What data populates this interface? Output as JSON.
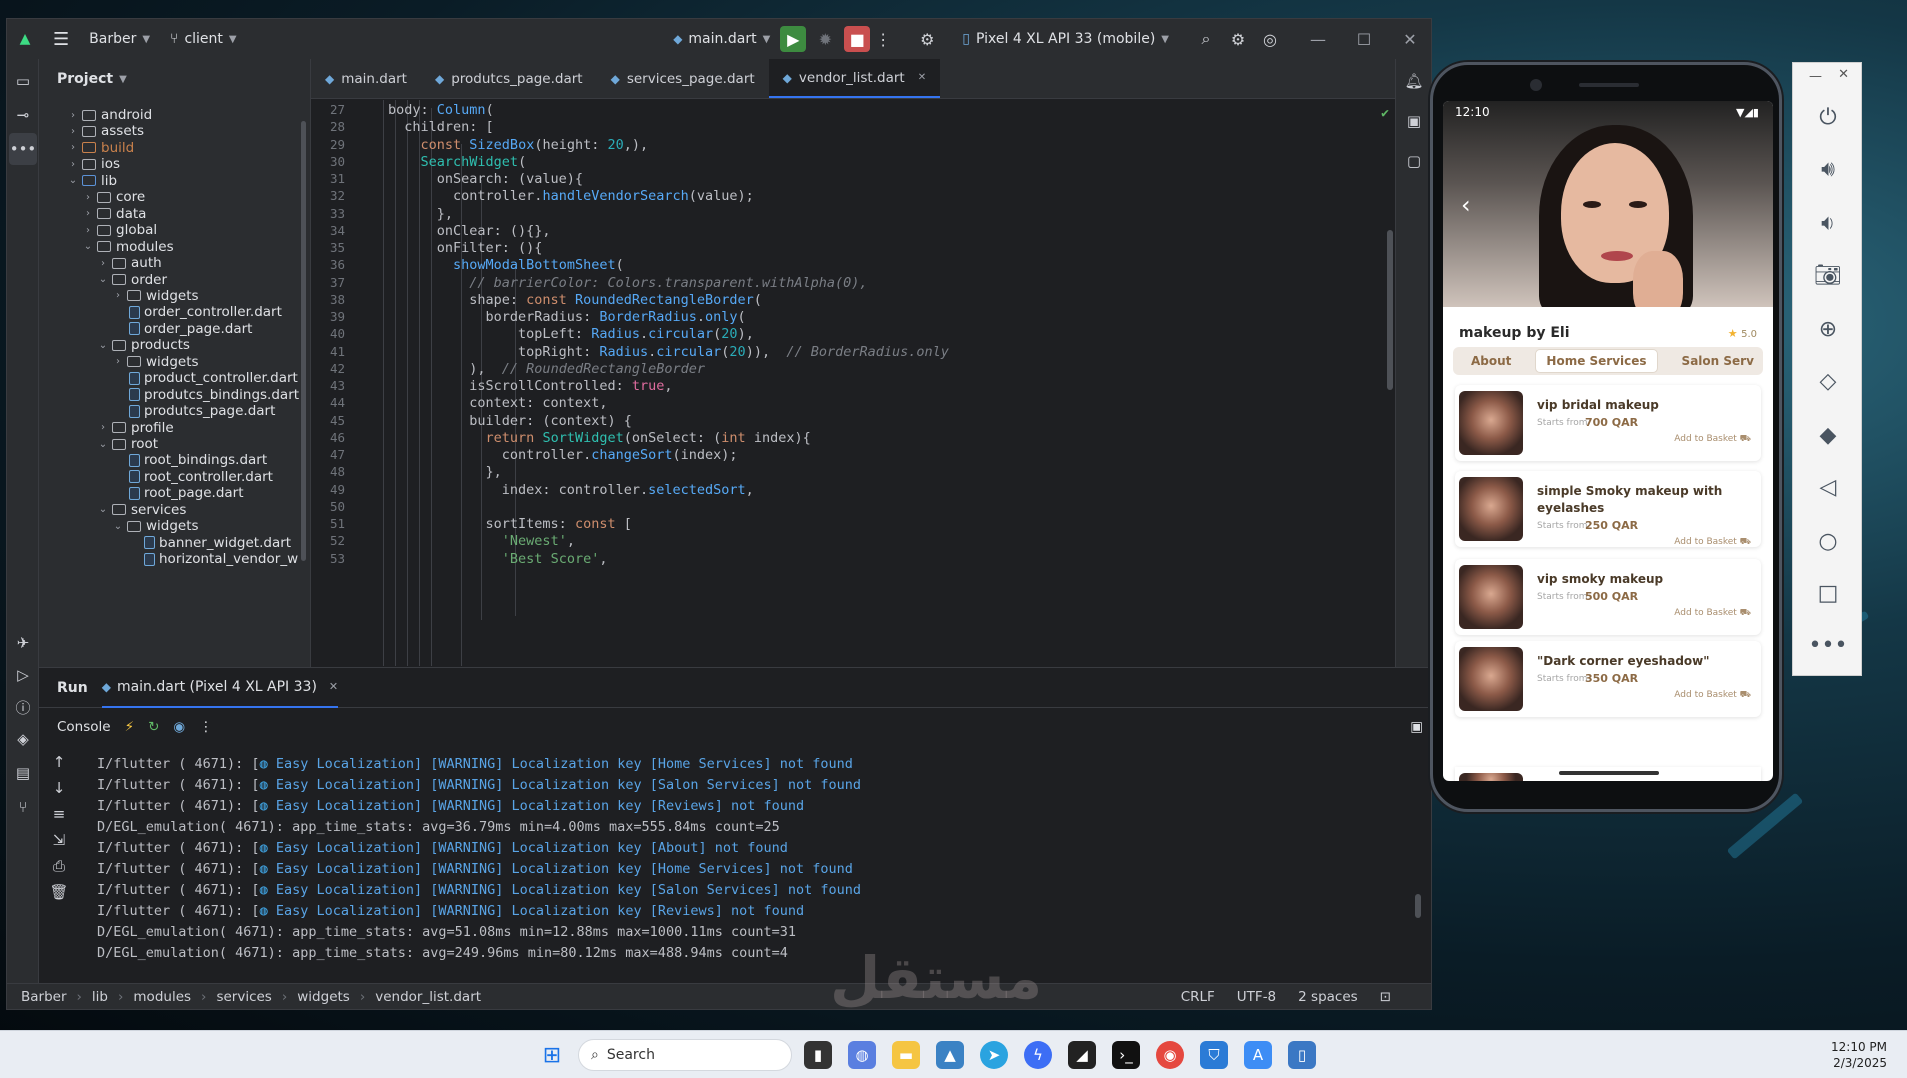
{
  "titlebar": {
    "project": "Barber",
    "branch": "client",
    "run_config": "main.dart",
    "device": "Pixel 4 XL API 33 (mobile)"
  },
  "project_panel": {
    "title": "Project"
  },
  "tree": [
    {
      "label": "android",
      "depth": 1,
      "kind": "folder",
      "open": false
    },
    {
      "label": "assets",
      "depth": 1,
      "kind": "folder",
      "open": false
    },
    {
      "label": "build",
      "depth": 1,
      "kind": "folder",
      "open": false,
      "cls": "build"
    },
    {
      "label": "ios",
      "depth": 1,
      "kind": "folder",
      "open": false
    },
    {
      "label": "lib",
      "depth": 1,
      "kind": "folder",
      "open": true,
      "cls": "lib"
    },
    {
      "label": "core",
      "depth": 2,
      "kind": "folder",
      "open": false
    },
    {
      "label": "data",
      "depth": 2,
      "kind": "folder",
      "open": false
    },
    {
      "label": "global",
      "depth": 2,
      "kind": "folder",
      "open": false
    },
    {
      "label": "modules",
      "depth": 2,
      "kind": "folder",
      "open": true
    },
    {
      "label": "auth",
      "depth": 3,
      "kind": "folder",
      "open": false
    },
    {
      "label": "order",
      "depth": 3,
      "kind": "folder",
      "open": true
    },
    {
      "label": "widgets",
      "depth": 4,
      "kind": "folder",
      "open": false
    },
    {
      "label": "order_controller.dart",
      "depth": 4,
      "kind": "file"
    },
    {
      "label": "order_page.dart",
      "depth": 4,
      "kind": "file"
    },
    {
      "label": "products",
      "depth": 3,
      "kind": "folder",
      "open": true
    },
    {
      "label": "widgets",
      "depth": 4,
      "kind": "folder",
      "open": false
    },
    {
      "label": "product_controller.dart",
      "depth": 4,
      "kind": "file"
    },
    {
      "label": "produtcs_bindings.dart",
      "depth": 4,
      "kind": "file"
    },
    {
      "label": "produtcs_page.dart",
      "depth": 4,
      "kind": "file"
    },
    {
      "label": "profile",
      "depth": 3,
      "kind": "folder",
      "open": false
    },
    {
      "label": "root",
      "depth": 3,
      "kind": "folder",
      "open": true
    },
    {
      "label": "root_bindings.dart",
      "depth": 4,
      "kind": "file"
    },
    {
      "label": "root_controller.dart",
      "depth": 4,
      "kind": "file"
    },
    {
      "label": "root_page.dart",
      "depth": 4,
      "kind": "file"
    },
    {
      "label": "services",
      "depth": 3,
      "kind": "folder",
      "open": true
    },
    {
      "label": "widgets",
      "depth": 4,
      "kind": "folder",
      "open": true
    },
    {
      "label": "banner_widget.dart",
      "depth": 5,
      "kind": "file"
    },
    {
      "label": "horizontal_vendor_w",
      "depth": 5,
      "kind": "file"
    }
  ],
  "tabs": [
    "main.dart",
    "produtcs_page.dart",
    "services_page.dart",
    "vendor_list.dart"
  ],
  "active_tab": 3,
  "code_lines": [
    {
      "n": "27",
      "html": "body: <span class='ty'>Column</span>("
    },
    {
      "n": "28",
      "html": "  children: ["
    },
    {
      "n": "29",
      "html": "    <span class='kw'>const</span> <span class='ty'>SizedBox</span>(height: <span class='num'>20</span>,),"
    },
    {
      "n": "30",
      "html": "    <span class='cls'>SearchWidget</span>("
    },
    {
      "n": "31",
      "html": "      onSearch: (value){"
    },
    {
      "n": "32",
      "html": "        controller.<span class='fn'>handleVendorSearch</span>(value);"
    },
    {
      "n": "33",
      "html": "      },"
    },
    {
      "n": "34",
      "html": "      onClear: (){},"
    },
    {
      "n": "35",
      "html": "      onFilter: (){"
    },
    {
      "n": "36",
      "html": "        <span class='fn'>showModalBottomSheet</span>("
    },
    {
      "n": "37",
      "html": "          <span class='cm'>// barrierColor: Colors.transparent.withAlpha(0),</span>"
    },
    {
      "n": "38",
      "html": "          shape: <span class='kw'>const</span> <span class='ty'>RoundedRectangleBorder</span>("
    },
    {
      "n": "39",
      "html": "            borderRadius: <span class='ty'>BorderRadius</span>.<span class='fn'>only</span>("
    },
    {
      "n": "40",
      "html": "                topLeft: <span class='ty'>Radius</span>.<span class='fn'>circular</span>(<span class='num'>20</span>),"
    },
    {
      "n": "41",
      "html": "                topRight: <span class='ty'>Radius</span>.<span class='fn'>circular</span>(<span class='num'>20</span>)),  <span class='cm'>// BorderRadius.only</span>"
    },
    {
      "n": "42",
      "html": "          ),  <span class='cm'>// RoundedRectangleBorder</span>"
    },
    {
      "n": "43",
      "html": "          isScrollControlled: <span class='pk'>true</span>,"
    },
    {
      "n": "44",
      "html": "          context: context,"
    },
    {
      "n": "45",
      "html": "          builder: (context) {"
    },
    {
      "n": "46",
      "html": "            <span class='kw'>return</span> <span class='cls'>SortWidget</span>(onSelect: (<span class='kw'>int</span> index){"
    },
    {
      "n": "47",
      "html": "              controller.<span class='fn'>changeSort</span>(index);"
    },
    {
      "n": "48",
      "html": "            },"
    },
    {
      "n": "49",
      "html": "              index: controller.<span class='fn'>selectedSort</span>,"
    },
    {
      "n": "50",
      "html": ""
    },
    {
      "n": "51",
      "html": "            sortItems: <span class='kw'>const</span> ["
    },
    {
      "n": "52",
      "html": "              <span class='str'>'Newest'</span>,"
    },
    {
      "n": "53",
      "html": "              <span class='str'>'Best Score'</span>,"
    }
  ],
  "run_panel": {
    "label": "Run",
    "config": "main.dart (Pixel 4 XL API 33)",
    "console": "Console"
  },
  "console_lines": [
    {
      "prefix": "I/flutter ( 4671): [",
      "msg": " Easy Localization] [WARNING] Localization key [Home Services] not found",
      "warn": true
    },
    {
      "prefix": "I/flutter ( 4671): [",
      "msg": " Easy Localization] [WARNING] Localization key [Salon Services] not found",
      "warn": true
    },
    {
      "prefix": "I/flutter ( 4671): [",
      "msg": " Easy Localization] [WARNING] Localization key [Reviews] not found",
      "warn": true
    },
    {
      "prefix": "D/EGL_emulation( 4671): app_time_stats: avg=36.79ms min=4.00ms max=555.84ms count=25",
      "msg": "",
      "warn": false
    },
    {
      "prefix": "I/flutter ( 4671): [",
      "msg": " Easy Localization] [WARNING] Localization key [About] not found",
      "warn": true
    },
    {
      "prefix": "I/flutter ( 4671): [",
      "msg": " Easy Localization] [WARNING] Localization key [Home Services] not found",
      "warn": true
    },
    {
      "prefix": "I/flutter ( 4671): [",
      "msg": " Easy Localization] [WARNING] Localization key [Salon Services] not found",
      "warn": true
    },
    {
      "prefix": "I/flutter ( 4671): [",
      "msg": " Easy Localization] [WARNING] Localization key [Reviews] not found",
      "warn": true
    },
    {
      "prefix": "D/EGL_emulation( 4671): app_time_stats: avg=51.08ms min=12.88ms max=1000.11ms count=31",
      "msg": "",
      "warn": false
    },
    {
      "prefix": "D/EGL_emulation( 4671): app_time_stats: avg=249.96ms min=80.12ms max=488.94ms count=4",
      "msg": "",
      "warn": false
    }
  ],
  "breadcrumb": [
    "Barber",
    "lib",
    "modules",
    "services",
    "widgets",
    "vendor_list.dart"
  ],
  "status": {
    "line_sep": "CRLF",
    "encoding": "UTF-8",
    "indent": "2 spaces"
  },
  "phone": {
    "time": "12:10",
    "vendor": "makeup by Eli",
    "rating": "5.0",
    "tabs": [
      "About",
      "Home Services",
      "Salon Serv"
    ],
    "active_tab": 1,
    "starts_from": "Starts from",
    "add_to_basket": "Add to Basket",
    "services": [
      {
        "title": "vip bridal makeup",
        "price": "700 QAR"
      },
      {
        "title": "simple Smoky makeup with eyelashes",
        "price": "250 QAR"
      },
      {
        "title": "vip smoky makeup",
        "price": "500 QAR"
      },
      {
        "title": "\"Dark corner eyeshadow\"",
        "price": "350 QAR"
      }
    ]
  },
  "taskbar": {
    "search": "Search",
    "time": "12:10 PM",
    "date": "2/3/2025"
  },
  "watermark": "مستقل"
}
